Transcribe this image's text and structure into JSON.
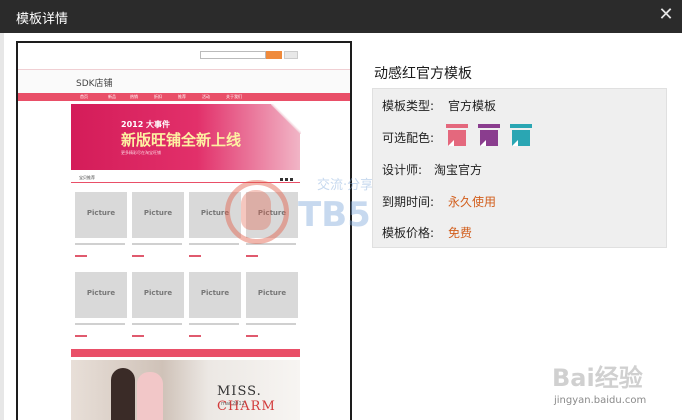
{
  "dialog": {
    "title": "模板详情",
    "close_glyph": "✕"
  },
  "preview": {
    "brand": "SDK店铺",
    "nav": [
      "首页",
      "新品",
      "热销",
      "折扣",
      "推荐",
      "活动",
      "关于我们"
    ],
    "banner_year": "2012 大事件",
    "banner_headline": "新版旺铺全新上线",
    "banner_sub": "更多精彩尽在淘宝旺铺",
    "section_title": "宝贝推荐",
    "picture_label": "Picture",
    "photo_title_a": "MISS.",
    "photo_title_b": "CHARM",
    "photo_sub": "mar.2012"
  },
  "info": {
    "template_name": "动感红官方模板",
    "rows": [
      {
        "label": "模板类型:",
        "value": "官方模板"
      },
      {
        "label": "可选配色:",
        "value": ""
      },
      {
        "label": "设计师:",
        "value": "淘宝官方"
      },
      {
        "label": "到期时间:",
        "value": "永久使用"
      },
      {
        "label": "模板价格:",
        "value": "免费"
      }
    ],
    "color_options": [
      {
        "name": "pink",
        "color": "#e4687d"
      },
      {
        "name": "purple",
        "color": "#8a3d8e"
      },
      {
        "name": "teal",
        "color": "#2aa6b3"
      }
    ],
    "accent": "#d25e1c"
  },
  "watermarks": {
    "tb_sub": "交流·分享·进步",
    "tb_main": "TB58.NET",
    "baidu_text": "Bai经验",
    "baidu_url": "jingyan.baidu.com"
  }
}
